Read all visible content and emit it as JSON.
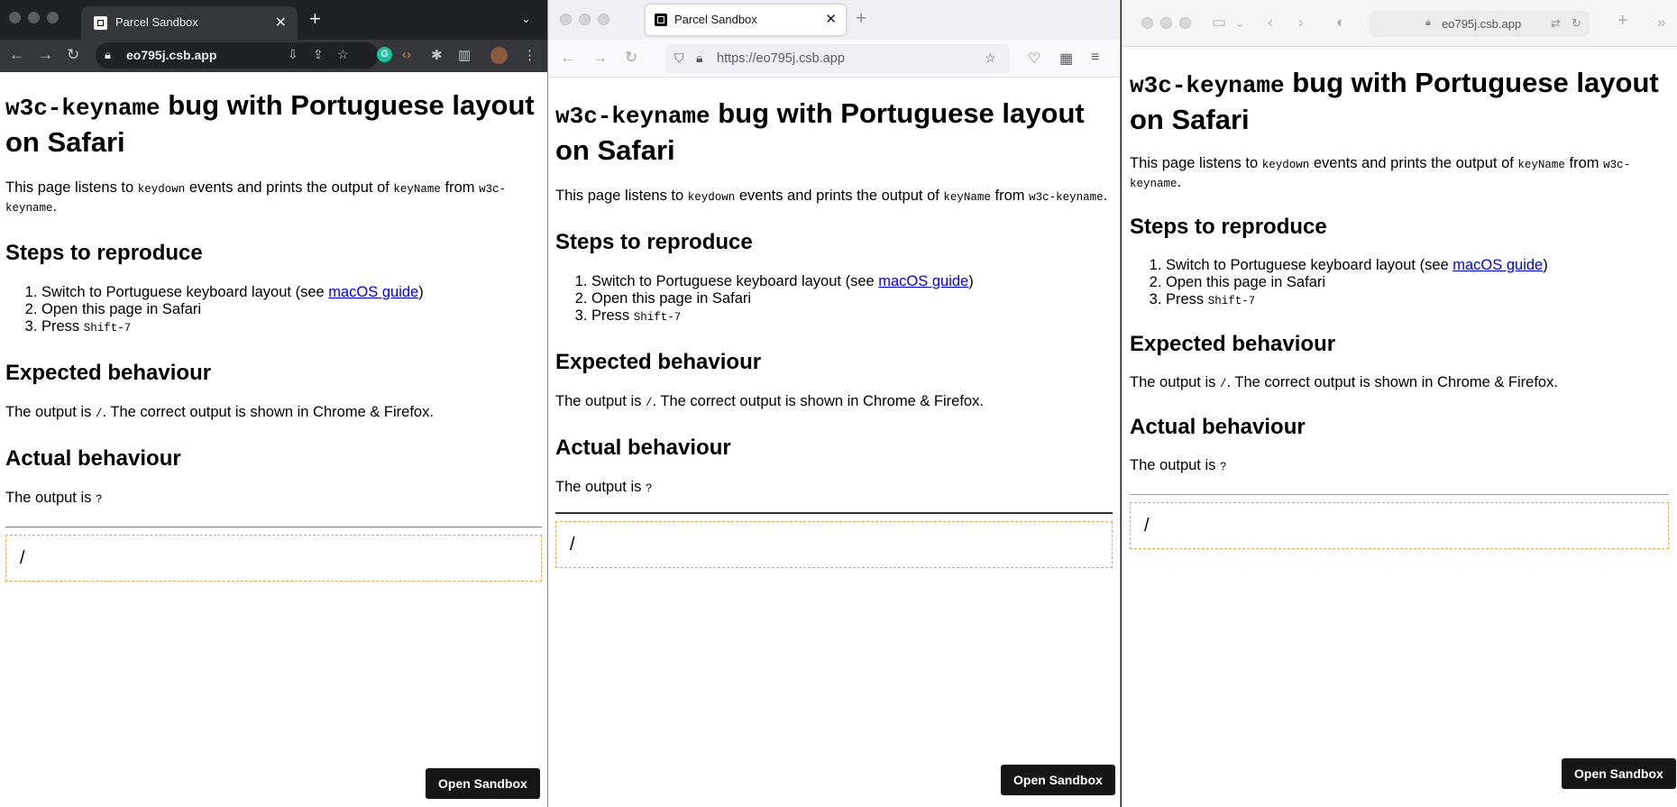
{
  "page": {
    "title_code": "w3c-keyname",
    "title_rest": " bug with Portuguese layout on Safari",
    "intro_1": "This page listens to ",
    "intro_code_1": "keydown",
    "intro_2": " events and prints the output of ",
    "intro_code_2": "keyName",
    "intro_3": " from ",
    "intro_code_3": "w3c-keyname",
    "intro_4": ".",
    "steps_heading": "Steps to reproduce",
    "step_1": "Switch to Portuguese keyboard layout (see ",
    "step_1_link": "macOS guide",
    "step_1_end": ")",
    "step_2": "Open this page in Safari",
    "step_3": "Press ",
    "step_3_code": "Shift-7",
    "expected_heading": "Expected behaviour",
    "expected_1": "The output is ",
    "expected_code": "/",
    "expected_2": ". The correct output is shown in Chrome & Firefox.",
    "actual_heading": "Actual behaviour",
    "actual_1": "The output is ",
    "actual_code": "?",
    "open_sandbox_label": "Open Sandbox"
  },
  "chrome": {
    "tab_title": "Parcel Sandbox",
    "url": "eo795j.csb.app",
    "output": "/"
  },
  "firefox": {
    "tab_title": "Parcel Sandbox",
    "url": "https://eo795j.csb.app",
    "output": "/"
  },
  "safari": {
    "url": "eo795j.csb.app",
    "output": "/"
  },
  "icons": {
    "back": "arrow-left-icon",
    "forward": "arrow-right-icon",
    "reload": "reload-icon",
    "lock": "lock-icon",
    "star": "star-icon",
    "menu": "menu-icon"
  },
  "colors": {
    "link": "#0000ee",
    "output_border": "#e6a54f",
    "button_bg": "#161616",
    "chrome_frame": "#202124"
  }
}
